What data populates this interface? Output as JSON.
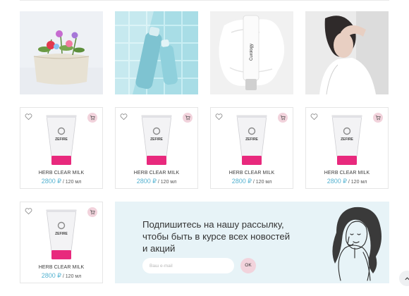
{
  "photos": [
    {
      "name": "cosmetic-bag-flowers"
    },
    {
      "name": "blue-bottles-pool"
    },
    {
      "name": "curology-bottle-cream",
      "brand_text": "Curology"
    },
    {
      "name": "woman-portrait"
    }
  ],
  "products": [
    {
      "brand": "ZEFIRE",
      "name": "HERB CLEAR MILK",
      "price": "2800 ₽",
      "volume": "/ 120 мл"
    },
    {
      "brand": "ZEFIRE",
      "name": "HERB CLEAR MILK",
      "price": "2800 ₽",
      "volume": "/ 120 мл"
    },
    {
      "brand": "ZEFIRE",
      "name": "HERB CLEAR MILK",
      "price": "2800 ₽",
      "volume": "/ 120 мл"
    },
    {
      "brand": "ZEFIRE",
      "name": "HERB CLEAR MILK",
      "price": "2800 ₽",
      "volume": "/ 120 мл"
    },
    {
      "brand": "ZEFIRE",
      "name": "HERB CLEAR MILK",
      "price": "2800 ₽",
      "volume": "/ 120 мл"
    }
  ],
  "subscribe": {
    "title_line1": "Подпишитесь на нашу рассылку,",
    "title_line2": "чтобы быть в курсе всех новостей",
    "title_line3": "и акций",
    "email_placeholder": "Ваш e-mail",
    "button_label": "OK"
  },
  "icons": {
    "wishlist": "heart-icon",
    "cart": "cart-icon",
    "scroll": "chevron-up-icon"
  },
  "colors": {
    "price_accent": "#56b3d1",
    "pink_accent": "#f2d3dc",
    "subscribe_bg": "#e7f3f7",
    "tube_cap": "#e8297d"
  }
}
